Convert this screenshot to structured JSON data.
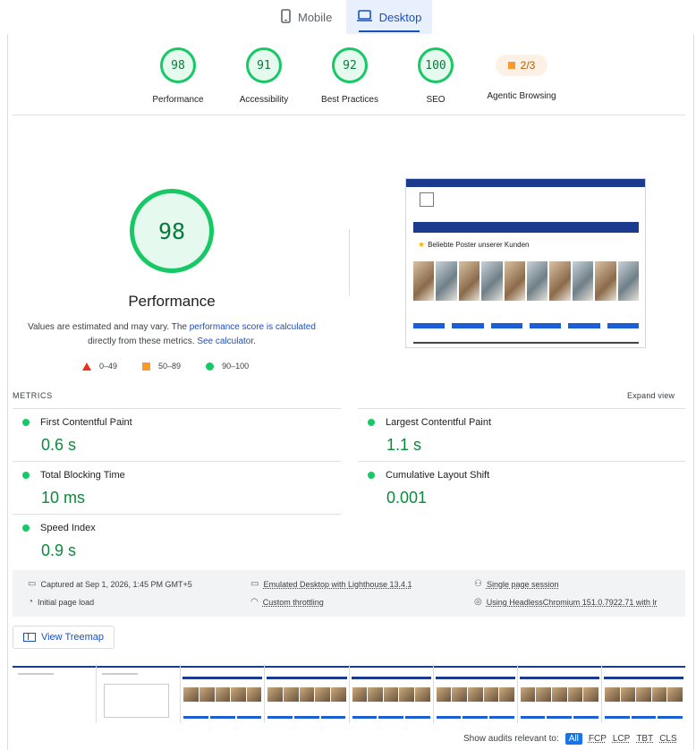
{
  "tabs": [
    {
      "label": "Mobile",
      "icon": "phone-icon"
    },
    {
      "label": "Desktop",
      "icon": "laptop-icon"
    }
  ],
  "gauges": [
    {
      "score": "98",
      "label": "Performance"
    },
    {
      "score": "91",
      "label": "Accessibility"
    },
    {
      "score": "92",
      "label": "Best Practices"
    },
    {
      "score": "100",
      "label": "SEO"
    }
  ],
  "agentic": {
    "score": "2/3",
    "label": "Agentic Browsing"
  },
  "main": {
    "score": "98",
    "title": "Performance",
    "note_prefix": "Values are estimated and may vary. The ",
    "note_link1": "performance score is calculated",
    "note_mid": " directly from these metrics. ",
    "note_link2": "See calculator",
    "note_suffix": "."
  },
  "legend": [
    {
      "range": "0–49",
      "color": "#e8311f"
    },
    {
      "range": "50–89",
      "color": "#fa9a2a"
    },
    {
      "range": "90–100",
      "color": "#17c964"
    }
  ],
  "thumb": {
    "heading": "Beliebte Poster unserer Kunden"
  },
  "metrics": {
    "header": "METRICS",
    "expand": "Expand view",
    "items": [
      {
        "name": "First Contentful Paint",
        "value": "0.6 s"
      },
      {
        "name": "Largest Contentful Paint",
        "value": "1.1 s"
      },
      {
        "name": "Total Blocking Time",
        "value": "10 ms"
      },
      {
        "name": "Cumulative Layout Shift",
        "value": "0.001"
      },
      {
        "name": "Speed Index",
        "value": "0.9 s"
      }
    ]
  },
  "info": {
    "captured": "Captured at Sep 1, 2026, 1:45 PM GMT+5",
    "emulated": "Emulated Desktop with Lighthouse 13.4.1",
    "session": "Single page session",
    "load": "Initial page load",
    "throttling": "Custom throttling",
    "browser": "Using HeadlessChromium 151.0.7922.71 with lr"
  },
  "treemap": "View Treemap",
  "audits": {
    "label": "Show audits relevant to:",
    "chips": [
      "All",
      "FCP",
      "LCP",
      "TBT",
      "CLS"
    ]
  },
  "colors": {
    "pass": "#17c964",
    "accent": "#1a4fbf",
    "average": "#fa9a2a"
  }
}
